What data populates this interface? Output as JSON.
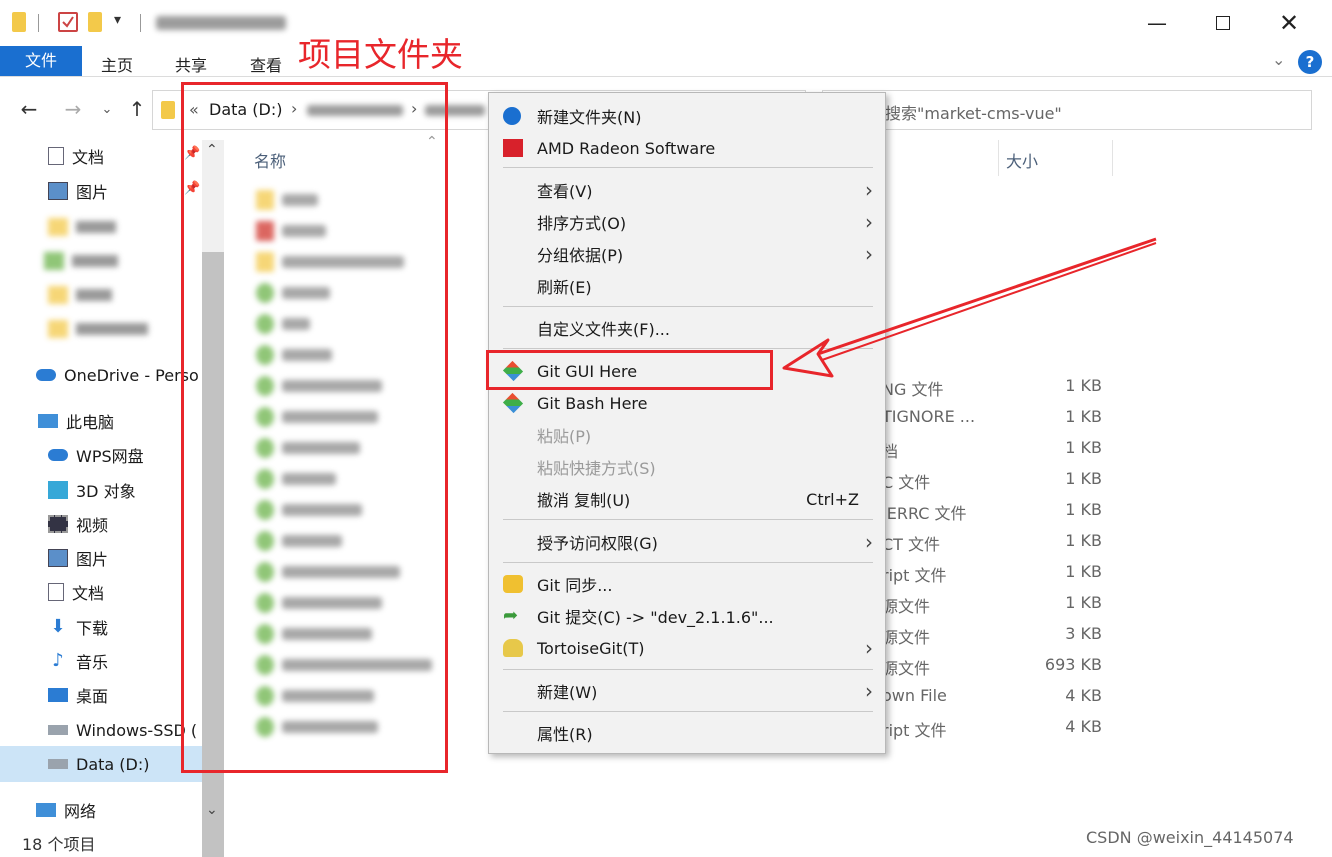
{
  "annotation": {
    "label": "项目文件夹"
  },
  "ribbon": {
    "tabs": [
      "文件",
      "主页",
      "共享",
      "查看"
    ]
  },
  "address": {
    "drive": "Data (D:)",
    "prefix": "«"
  },
  "search": {
    "placeholder": "搜索\"market-cms-vue\""
  },
  "columns": {
    "name": "名称",
    "size": "大小"
  },
  "nav": {
    "items": [
      {
        "label": "文档",
        "icon": "document-icon"
      },
      {
        "label": "图片",
        "icon": "picture-icon"
      },
      {
        "label": "OneDrive - Perso",
        "icon": "cloud-icon"
      },
      {
        "label": "此电脑",
        "icon": "computer-icon"
      },
      {
        "label": "WPS网盘",
        "icon": "wps-cloud-icon"
      },
      {
        "label": "3D 对象",
        "icon": "cube-icon"
      },
      {
        "label": "视频",
        "icon": "video-icon"
      },
      {
        "label": "图片",
        "icon": "picture-icon"
      },
      {
        "label": "文档",
        "icon": "document-icon"
      },
      {
        "label": "下载",
        "icon": "download-icon"
      },
      {
        "label": "音乐",
        "icon": "music-icon"
      },
      {
        "label": "桌面",
        "icon": "desktop-icon"
      },
      {
        "label": "Windows-SSD (",
        "icon": "drive-icon"
      },
      {
        "label": "Data (D:)",
        "icon": "drive-icon"
      },
      {
        "label": "网络",
        "icon": "network-icon"
      }
    ]
  },
  "status": {
    "count": "18 个项目"
  },
  "details": {
    "types": [
      "NG 文件",
      "TIGNORE ...",
      "档",
      "C 文件",
      "IERRC 文件",
      "CT 文件",
      "ript 文件",
      "源文件",
      "源文件",
      "源文件",
      "own File",
      "ript 文件"
    ],
    "sizes": [
      "1 KB",
      "1 KB",
      "1 KB",
      "1 KB",
      "1 KB",
      "1 KB",
      "1 KB",
      "1 KB",
      "3 KB",
      "693 KB",
      "4 KB",
      "4 KB"
    ]
  },
  "menu": {
    "new_folder": "新建文件夹(N)",
    "amd": "AMD Radeon Software",
    "view": "查看(V)",
    "sort": "排序方式(O)",
    "group": "分组依据(P)",
    "refresh": "刷新(E)",
    "customize": "自定义文件夹(F)...",
    "git_gui": "Git GUI Here",
    "git_bash": "Git Bash Here",
    "paste": "粘贴(P)",
    "paste_shortcut": "粘贴快捷方式(S)",
    "undo": "撤消 复制(U)",
    "undo_shortcut": "Ctrl+Z",
    "grant_access": "授予访问权限(G)",
    "git_sync": "Git 同步...",
    "git_commit": "Git 提交(C) -> \"dev_2.1.1.6\"...",
    "tortoise": "TortoiseGit(T)",
    "new": "新建(W)",
    "properties": "属性(R)"
  },
  "watermark": "CSDN @weixin_44145074",
  "colors": {
    "accent": "#1a6fd0",
    "annotation": "#e8262b",
    "menu_bg": "#f2f2f2",
    "folder": "#f3c94a"
  }
}
